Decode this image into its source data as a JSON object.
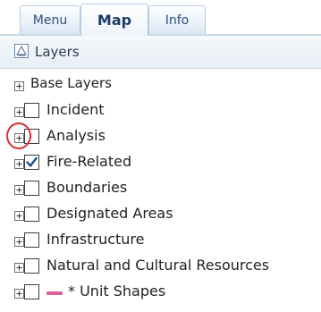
{
  "tabs": {
    "menu": "Menu",
    "map": "Map",
    "info": "Info",
    "active": "Map"
  },
  "layers": {
    "title": "Layers",
    "icon": "layers-icon",
    "base": {
      "label": "Base Layers",
      "expanded": false
    },
    "items": [
      {
        "label": "Incident",
        "checked": false,
        "expanded": false
      },
      {
        "label": "Analysis",
        "checked": false,
        "expanded": false,
        "highlighted": true
      },
      {
        "label": "Fire-Related",
        "checked": true,
        "expanded": false
      },
      {
        "label": "Boundaries",
        "checked": false,
        "expanded": false
      },
      {
        "label": "Designated Areas",
        "checked": false,
        "expanded": false
      },
      {
        "label": "Infrastructure",
        "checked": false,
        "expanded": false
      },
      {
        "label": "Natural and Cultural Resources",
        "checked": false,
        "expanded": false
      },
      {
        "label": "* Unit Shapes",
        "checked": false,
        "expanded": false,
        "swatch_color": "#e0609d"
      }
    ]
  },
  "colors": {
    "highlight": "#d83034",
    "tab_text": "#2f4f7f"
  }
}
